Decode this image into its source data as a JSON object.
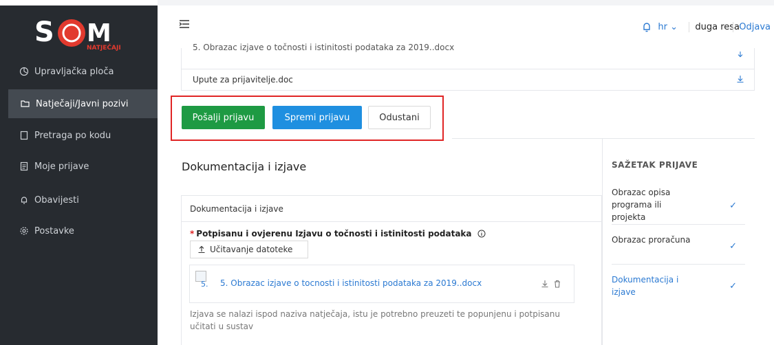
{
  "brand": {
    "logo_text": "S",
    "logo_sub": "NATJEČAJI"
  },
  "sidebar": {
    "items": [
      {
        "label": "Upravljačka ploča",
        "icon": "dashboard-icon"
      },
      {
        "label": "Natječaji/Javni pozivi",
        "icon": "folder-open-icon"
      },
      {
        "label": "Pretraga po kodu",
        "icon": "document-icon"
      },
      {
        "label": "Moje prijave",
        "icon": "file-text-icon"
      },
      {
        "label": "Obavijesti",
        "icon": "bell-icon"
      },
      {
        "label": "Postavke",
        "icon": "gear-icon"
      }
    ]
  },
  "header": {
    "language": "hr",
    "organization": "duga resa",
    "logout": "Odjava"
  },
  "files": {
    "partial": "5. Obrazac izjave o točnosti i istinitosti podataka za 2019..docx",
    "second": "Upute za prijavitelje.doc"
  },
  "actions": {
    "send": "Pošalji prijavu",
    "save": "Spremi prijavu",
    "cancel": "Odustani"
  },
  "section": {
    "title": "Dokumentacija i izjave",
    "card_title": "Dokumentacija i izjave",
    "required_label": "Potpisanu i ovjerenu Izjavu o točnosti i istinitosti podataka",
    "upload_label": "Učitavanje datoteke",
    "attachment_num": "5.",
    "attachment_name": "5. Obrazac izjave o tocnosti i istinitosti podataka za 2019..docx",
    "hint": "Izjava se nalazi ispod naziva natječaja, istu je potrebno preuzeti te popunjenu i potpisanu učitati u sustav"
  },
  "summary": {
    "title": "SAŽETAK PRIJAVE",
    "items": [
      {
        "label": "Obrazac opisa programa ili projekta",
        "done": true
      },
      {
        "label": "Obrazac proračuna",
        "done": true
      },
      {
        "label": "Dokumentacija i izjave",
        "done": true
      }
    ],
    "check": "✓"
  },
  "colors": {
    "accent": "#1f8fe0",
    "success": "#1e9a43",
    "danger": "#e02424",
    "sidebar": "#272b30"
  }
}
